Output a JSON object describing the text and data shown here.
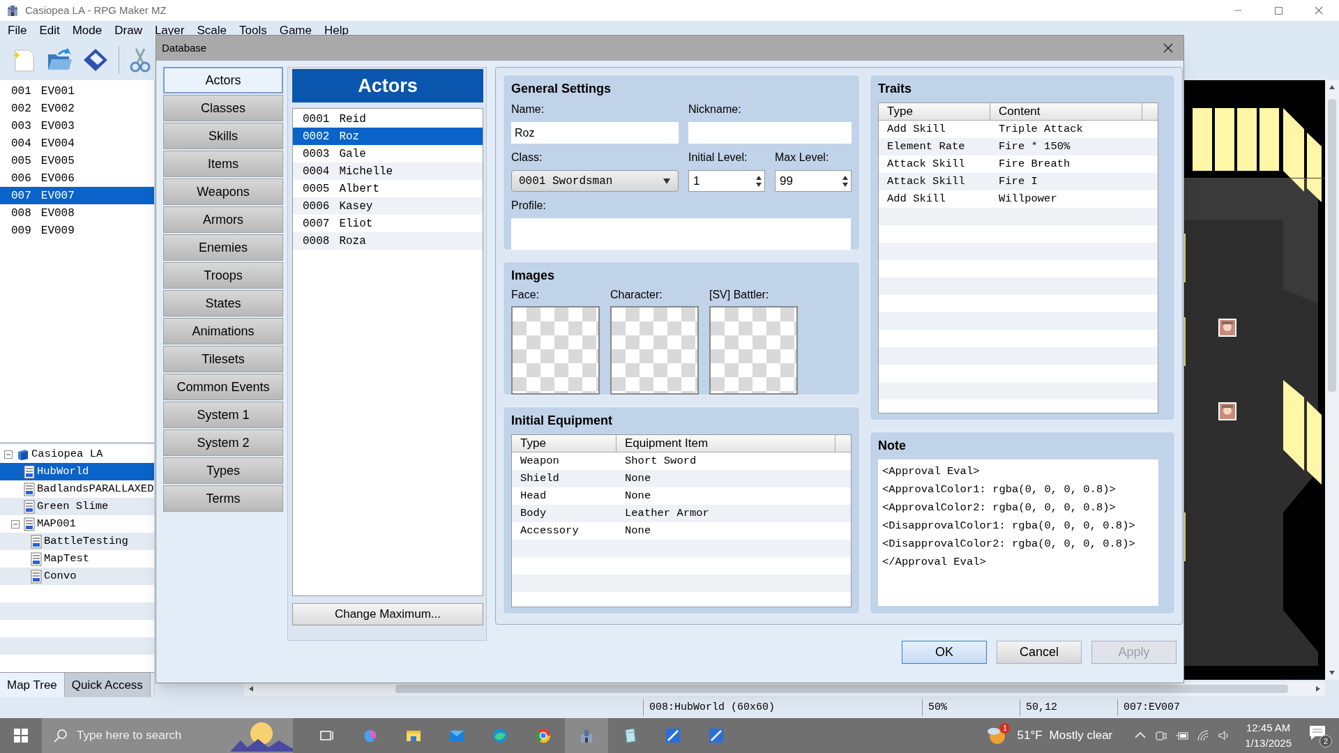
{
  "app_window": {
    "title": "Casiopea LA - RPG Maker MZ"
  },
  "menu": [
    "File",
    "Edit",
    "Mode",
    "Draw",
    "Layer",
    "Scale",
    "Tools",
    "Game",
    "Help"
  ],
  "event_list": [
    {
      "id": "001",
      "name": "EV001",
      "selected": false
    },
    {
      "id": "002",
      "name": "EV002",
      "selected": false
    },
    {
      "id": "003",
      "name": "EV003",
      "selected": false
    },
    {
      "id": "004",
      "name": "EV004",
      "selected": false
    },
    {
      "id": "005",
      "name": "EV005",
      "selected": false
    },
    {
      "id": "006",
      "name": "EV006",
      "selected": false
    },
    {
      "id": "007",
      "name": "EV007",
      "selected": true
    },
    {
      "id": "008",
      "name": "EV008",
      "selected": false
    },
    {
      "id": "009",
      "name": "EV009",
      "selected": false
    }
  ],
  "map_tree": [
    {
      "label": "Casiopea LA",
      "kind": "project",
      "expanded": true,
      "selected": false,
      "children": [
        {
          "label": "HubWorld",
          "kind": "map",
          "selected": true
        },
        {
          "label": "BadlandsPARALLAXED",
          "kind": "map",
          "selected": false
        },
        {
          "label": "Green Slime",
          "kind": "map",
          "selected": false
        },
        {
          "label": "MAP001",
          "kind": "map",
          "expanded": true,
          "selected": false,
          "children": [
            {
              "label": "BattleTesting",
              "kind": "map",
              "selected": false
            },
            {
              "label": "MapTest",
              "kind": "map",
              "selected": false
            },
            {
              "label": "Convo",
              "kind": "map",
              "selected": false
            }
          ]
        }
      ]
    }
  ],
  "left_tabs": [
    {
      "label": "Map Tree",
      "selected": true
    },
    {
      "label": "Quick Access",
      "selected": false
    }
  ],
  "database": {
    "title": "Database",
    "categories": [
      {
        "label": "Actors",
        "selected": true
      },
      {
        "label": "Classes",
        "selected": false
      },
      {
        "label": "Skills",
        "selected": false
      },
      {
        "label": "Items",
        "selected": false
      },
      {
        "label": "Weapons",
        "selected": false
      },
      {
        "label": "Armors",
        "selected": false
      },
      {
        "label": "Enemies",
        "selected": false
      },
      {
        "label": "Troops",
        "selected": false
      },
      {
        "label": "States",
        "selected": false
      },
      {
        "label": "Animations",
        "selected": false
      },
      {
        "label": "Tilesets",
        "selected": false
      },
      {
        "label": "Common Events",
        "selected": false
      },
      {
        "label": "System 1",
        "selected": false
      },
      {
        "label": "System 2",
        "selected": false
      },
      {
        "label": "Types",
        "selected": false
      },
      {
        "label": "Terms",
        "selected": false
      }
    ],
    "list_header": "Actors",
    "actors": [
      {
        "id": "0001",
        "name": "Reid",
        "selected": false
      },
      {
        "id": "0002",
        "name": "Roz",
        "selected": true
      },
      {
        "id": "0003",
        "name": "Gale",
        "selected": false
      },
      {
        "id": "0004",
        "name": "Michelle",
        "selected": false
      },
      {
        "id": "0005",
        "name": "Albert",
        "selected": false
      },
      {
        "id": "0006",
        "name": "Kasey",
        "selected": false
      },
      {
        "id": "0007",
        "name": "Eliot",
        "selected": false
      },
      {
        "id": "0008",
        "name": "Roza",
        "selected": false
      }
    ],
    "change_maximum": "Change Maximum...",
    "general": {
      "title": "General Settings",
      "name_label": "Name:",
      "name_value": "Roz",
      "nickname_label": "Nickname:",
      "class_label": "Class:",
      "class_value": "0001 Swordsman",
      "initial_level_label": "Initial Level:",
      "initial_level": "1",
      "max_level_label": "Max Level:",
      "max_level": "99",
      "profile_label": "Profile:"
    },
    "images": {
      "title": "Images",
      "labels": [
        "Face:",
        "Character:",
        "[SV] Battler:"
      ]
    },
    "equipment": {
      "title": "Initial Equipment",
      "columns": [
        "Type",
        "Equipment Item"
      ],
      "rows": [
        [
          "Weapon",
          "Short Sword"
        ],
        [
          "Shield",
          "None"
        ],
        [
          "Head",
          "None"
        ],
        [
          "Body",
          "Leather Armor"
        ],
        [
          "Accessory",
          "None"
        ]
      ]
    },
    "traits": {
      "title": "Traits",
      "columns": [
        "Type",
        "Content"
      ],
      "rows": [
        [
          "Add Skill",
          "Triple Attack"
        ],
        [
          "Element Rate",
          "Fire * 150%"
        ],
        [
          "Attack Skill",
          "Fire Breath"
        ],
        [
          "Attack Skill",
          "Fire I"
        ],
        [
          "Add Skill",
          "Willpower"
        ]
      ]
    },
    "note": {
      "title": "Note",
      "lines": [
        "<Approval Eval>",
        "<ApprovalColor1: rgba(0, 0, 0, 0.8)>",
        "<ApprovalColor2: rgba(0, 0, 0, 0.8)>",
        "<DisapprovalColor1: rgba(0, 0, 0, 0.8)>",
        "<DisapprovalColor2: rgba(0, 0, 0, 0.8)>",
        "</Approval Eval>"
      ]
    },
    "buttons": [
      {
        "label": "OK",
        "default": true,
        "disabled": false
      },
      {
        "label": "Cancel",
        "default": false,
        "disabled": false
      },
      {
        "label": "Apply",
        "default": false,
        "disabled": true
      }
    ]
  },
  "status_bar": [
    "008:HubWorld (60x60)",
    "50%",
    "50,12",
    "007:EV007"
  ],
  "taskbar": {
    "search_placeholder": "Type here to search",
    "temperature": "51°F",
    "weather": "Mostly clear",
    "weather_badge": "1",
    "time": "12:45 AM",
    "date": "1/13/2025",
    "notification_count": "2"
  }
}
